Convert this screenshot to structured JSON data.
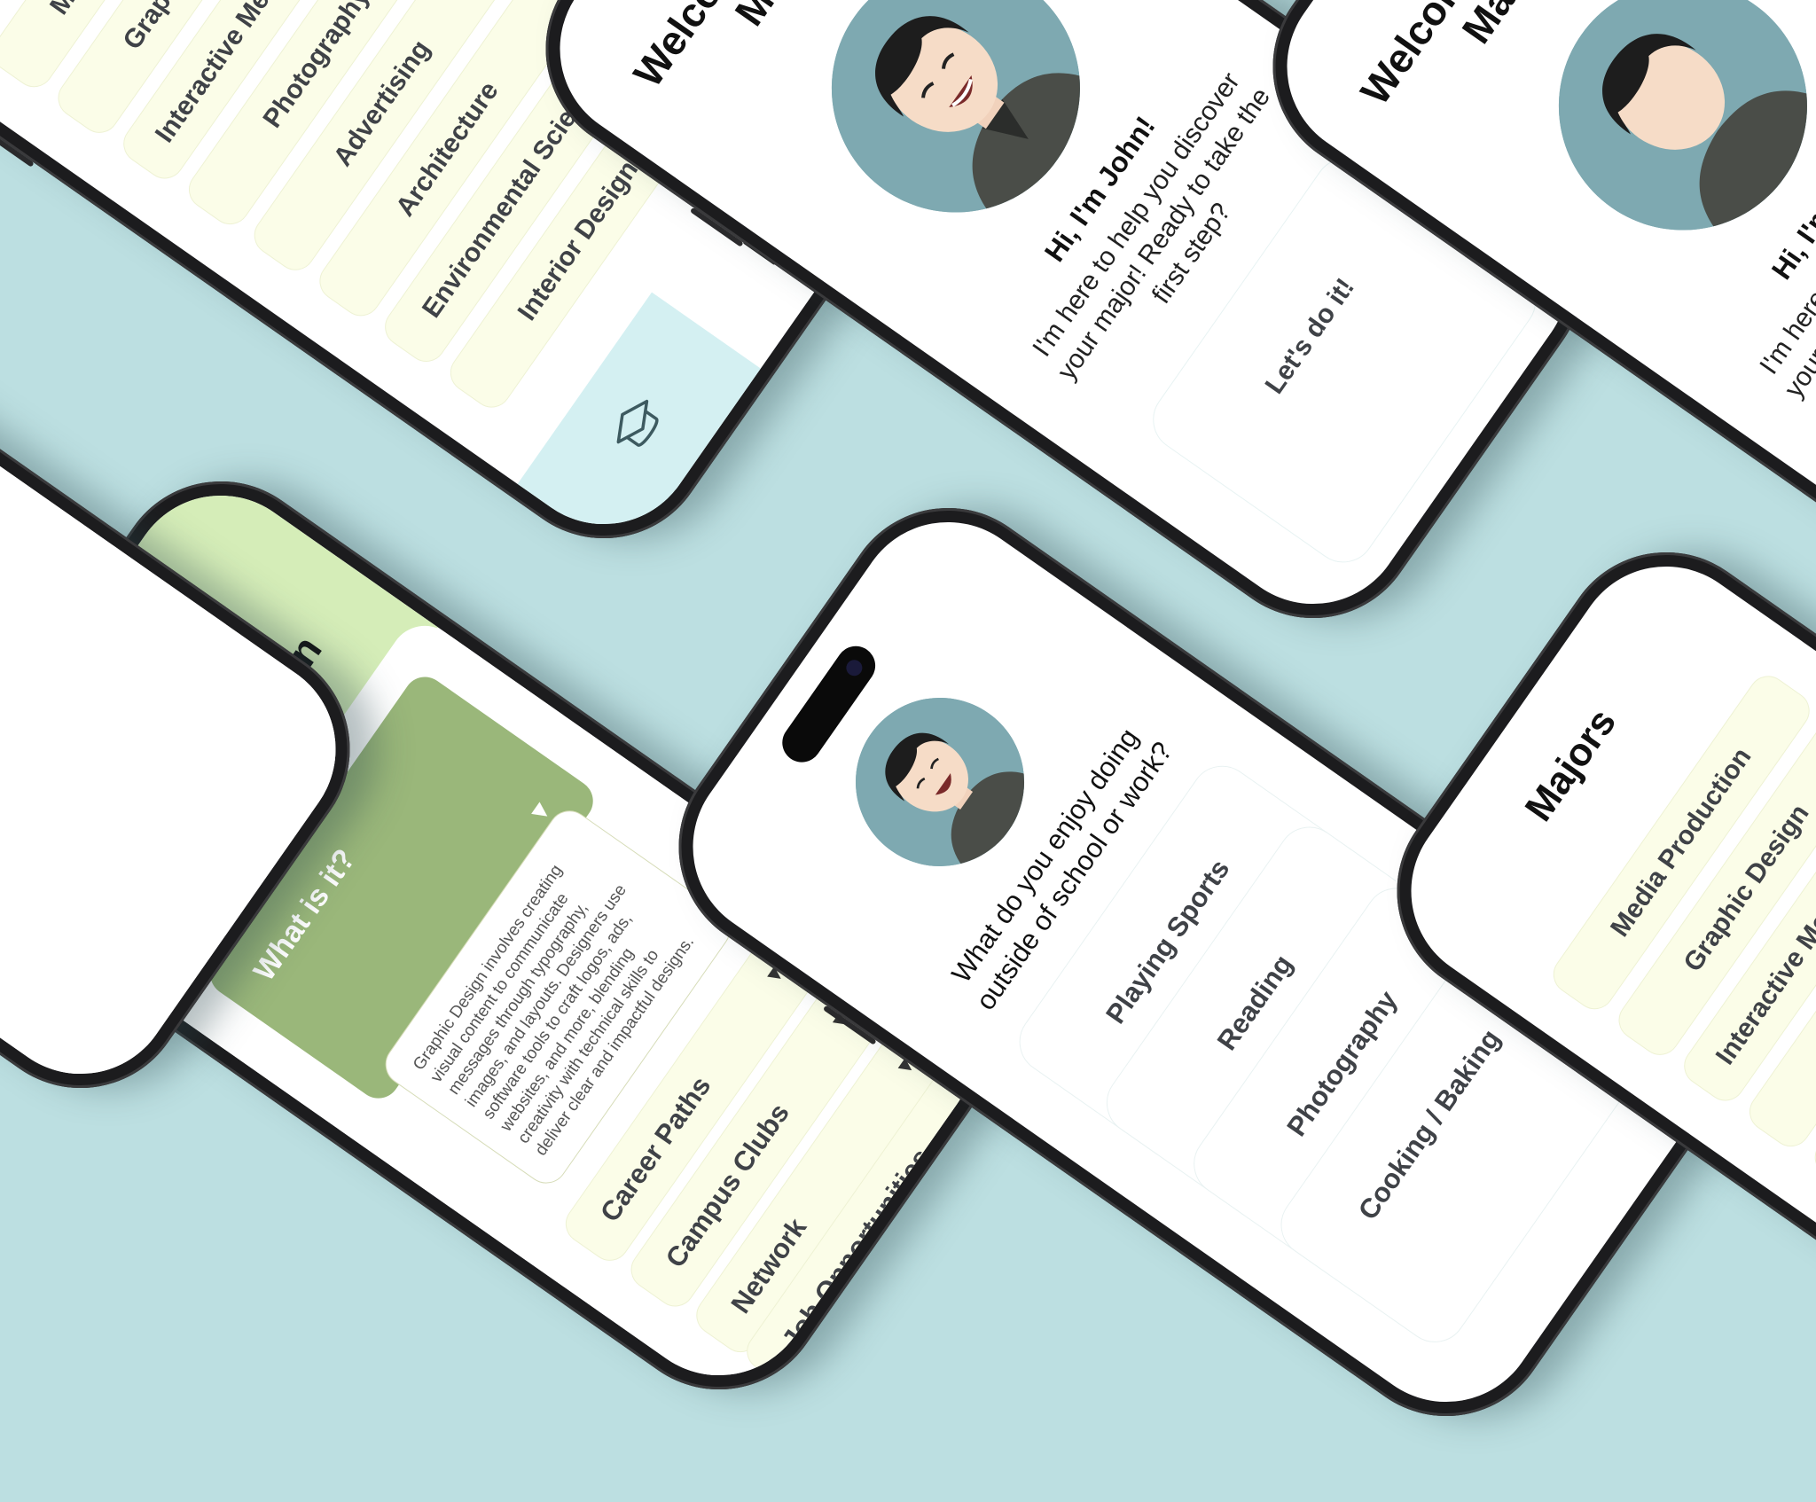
{
  "majors_screen": {
    "title": "Majors",
    "items": [
      "Media Production",
      "Graphic Design",
      "Interactive Media Design",
      "Photography",
      "Advertising",
      "Architecture",
      "Environmental Science",
      "Interior Design"
    ],
    "tabs": [
      {
        "icon": "graduation-cap-icon",
        "active": true
      },
      {
        "icon": "book-icon",
        "active": false
      }
    ]
  },
  "welcome_screen": {
    "title": "Welcome to Major Match!",
    "greeting": "Hi, I'm John!",
    "intro": "I'm here to help you discover your major! Ready to take the first step?",
    "cta_label": "Let's do it!"
  },
  "detail_screen": {
    "back_icon": "arrow-left-icon",
    "title": "Graphic Design",
    "accordion_title": "What is it?",
    "description": "Graphic Design involves creating visual content to communicate messages through typography, images, and layouts. Designers use software tools to craft logos, ads, websites, and more, blending creativity with technical skills to deliver clear and impactful designs.",
    "sections": [
      "Career Paths",
      "Campus Clubs",
      "Network",
      "Job Opportunities"
    ],
    "caret": "▼"
  },
  "quiz_screen": {
    "question": "What do you enjoy doing outside of school or work?",
    "options": [
      "Playing Sports",
      "Reading",
      "Photography",
      "Cooking / Baking"
    ]
  },
  "colors": {
    "background": "#bcdfe1",
    "header_green": "#d5edb8",
    "accent_green": "#9ab77a",
    "item_cream": "#fbfde8",
    "tab_active": "#d4f0f2",
    "avatar_bg": "#7ea9b1"
  }
}
